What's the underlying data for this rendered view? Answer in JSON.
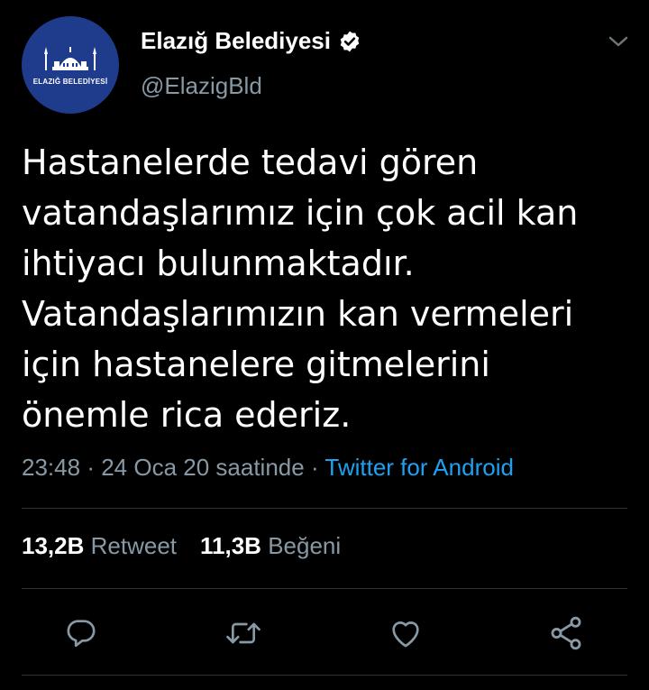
{
  "account": {
    "display_name": "Elazığ Belediyesi",
    "handle": "@ElazigBld",
    "avatar_text": "ELAZIĞ BELEDİYESİ",
    "verified": true
  },
  "tweet": {
    "text": "Hastanelerde tedavi gören\nvatandaşlarımız için çok acil kan\nihtiyacı bulunmaktadır.\nVatandaşlarımızın kan vermeleri\niçin hastanelere gitmelerini\nönemle rica ederiz.",
    "time": "23:48",
    "date": "24 Oca 20 saatinde",
    "separator": "·",
    "source": "Twitter for Android"
  },
  "stats": {
    "retweets_count": "13,2B",
    "retweets_label": "Retweet",
    "likes_count": "11,3B",
    "likes_label": "Beğeni"
  },
  "actions": [
    "reply-icon",
    "retweet-icon",
    "like-icon",
    "share-icon"
  ],
  "colors": {
    "background": "#000000",
    "secondary_text": "#8899a6",
    "link": "#1da1f2",
    "avatar_bg": "#1f3b8c",
    "divider": "#2f3336"
  }
}
